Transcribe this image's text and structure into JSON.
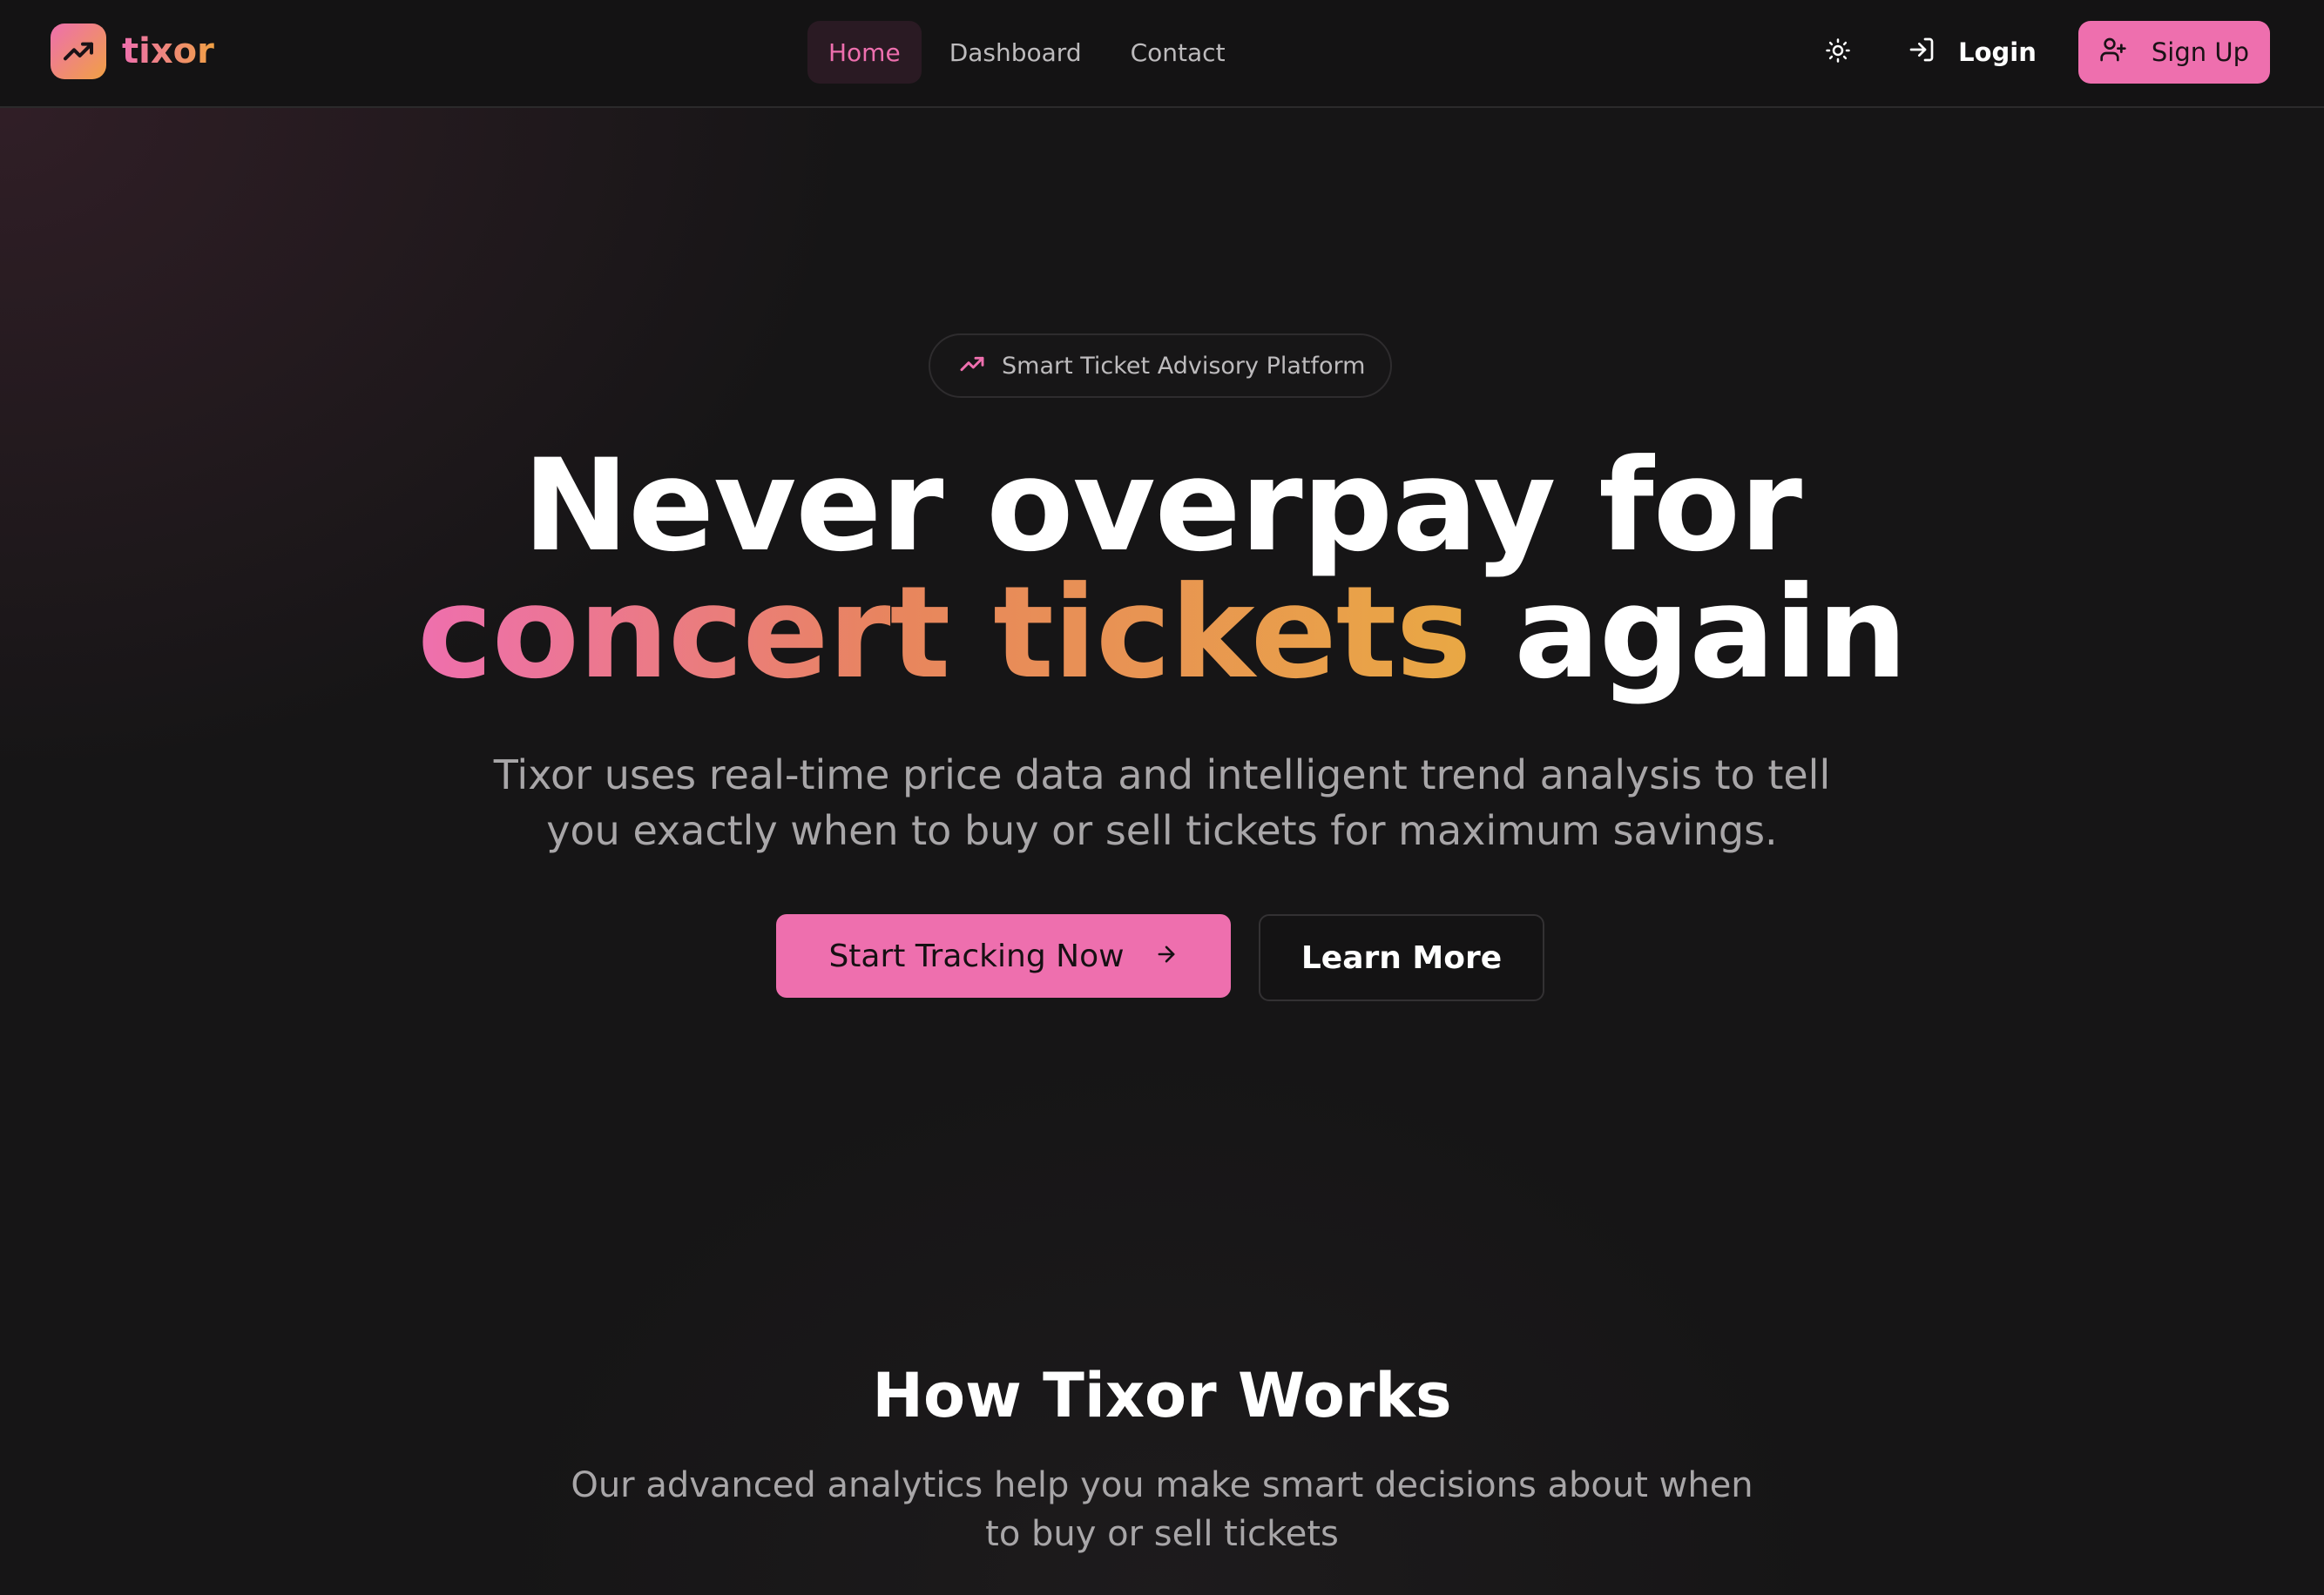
{
  "brand": {
    "name": "tixor",
    "logo_icon": "trending-up-icon"
  },
  "nav": {
    "links": [
      {
        "label": "Home",
        "active": true
      },
      {
        "label": "Dashboard",
        "active": false
      },
      {
        "label": "Contact",
        "active": false
      }
    ],
    "theme_icon": "sun-icon",
    "login": {
      "label": "Login",
      "icon": "log-in-icon"
    },
    "signup": {
      "label": "Sign Up",
      "icon": "user-plus-icon"
    }
  },
  "hero": {
    "badge": {
      "icon": "trending-up-icon",
      "text": "Smart Ticket Advisory Platform"
    },
    "headline_line1": "Never overpay for",
    "headline_highlight": "concert tickets",
    "headline_rest": "again",
    "subtext": "Tixor uses real-time price data and intelligent trend analysis to tell you exactly when to buy or sell tickets for maximum savings.",
    "cta_primary": "Start Tracking Now",
    "cta_secondary": "Learn More"
  },
  "how_it_works": {
    "title": "How Tixor Works",
    "subtitle": "Our advanced analytics help you make smart decisions about when to buy or sell tickets"
  },
  "colors": {
    "accent_pink": "#ee6fae",
    "accent_orange": "#f0a044",
    "background": "#161516"
  }
}
